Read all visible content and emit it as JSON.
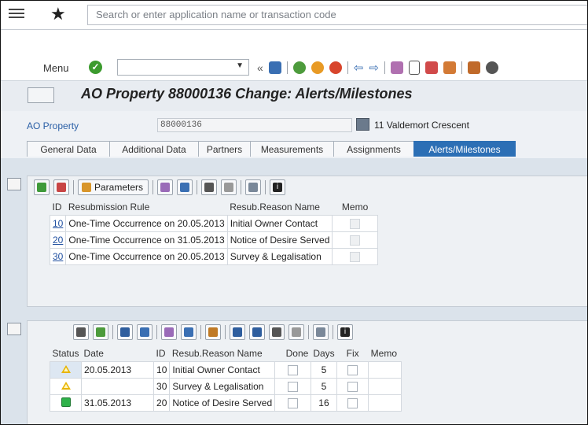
{
  "search": {
    "placeholder": "Search or enter application name or transaction code"
  },
  "toolbar": {
    "menu_label": "Menu"
  },
  "title": "AO Property 88000136 Change: Alerts/Milestones",
  "header": {
    "object_label": "AO Property",
    "object_id": "88000136",
    "address": "11 Valdemort Crescent"
  },
  "tabs": [
    "General Data",
    "Additional Data",
    "Partners",
    "Measurements",
    "Assignments",
    "Alerts/Milestones"
  ],
  "active_tab": 5,
  "colors": {
    "accent": "#2c6fb5",
    "link": "#1f4fa0"
  },
  "grid1": {
    "params_label": "Parameters",
    "headers": [
      "ID",
      "Resubmission Rule",
      "Resub.Reason Name",
      "Memo"
    ],
    "rows": [
      {
        "id": "10",
        "rule": "One-Time Occurrence on 20.05.2013",
        "reason": "Initial Owner Contact"
      },
      {
        "id": "20",
        "rule": "One-Time Occurrence on 31.05.2013",
        "reason": "Notice of Desire Served"
      },
      {
        "id": "30",
        "rule": "One-Time Occurrence on 20.05.2013",
        "reason": "Survey & Legalisation"
      }
    ]
  },
  "grid2": {
    "headers": [
      "Status",
      "Date",
      "ID",
      "Resub.Reason Name",
      "Done",
      "Days",
      "Fix",
      "Memo"
    ],
    "rows": [
      {
        "status": "warning",
        "date": "20.05.2013",
        "id": "10",
        "reason": "Initial Owner Contact",
        "days": "5"
      },
      {
        "status": "warning",
        "date": "",
        "id": "30",
        "reason": "Survey & Legalisation",
        "days": "5"
      },
      {
        "status": "ok",
        "date": "31.05.2013",
        "id": "20",
        "reason": "Notice of Desire Served",
        "days": "16"
      }
    ]
  }
}
